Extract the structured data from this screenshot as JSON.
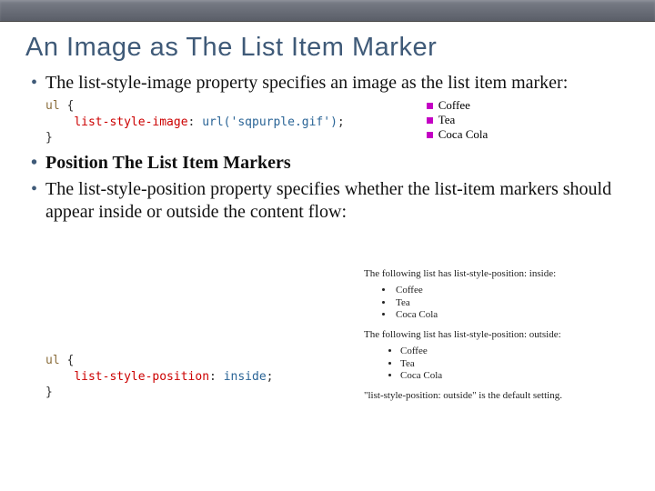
{
  "title": "An Image as The List Item Marker",
  "bullets": {
    "b1": "The list-style-image property specifies an image as the list item marker:",
    "b2": "Position The List Item Markers",
    "b3": "The list-style-position property specifies whether the list-item markers should appear inside or outside the content flow:"
  },
  "code1": {
    "selector": "ul",
    "brace_open": " {",
    "indent": "    ",
    "property": "list-style-image",
    "colon": ": ",
    "value": "url('sqpurple.gif')",
    "semi": ";",
    "brace_close": "}"
  },
  "example1": {
    "items": [
      "Coffee",
      "Tea",
      "Coca Cola"
    ]
  },
  "code2": {
    "selector": "ul",
    "brace_open": " {",
    "indent": "    ",
    "property": "list-style-position",
    "colon": ": ",
    "value": "inside",
    "semi": ";",
    "brace_close": "}"
  },
  "position_example": {
    "caption_inside": "The following list has list-style-position: inside:",
    "caption_outside": "The following list has list-style-position: outside:",
    "items": [
      "Coffee",
      "Tea",
      "Coca Cola"
    ],
    "note": "\"list-style-position: outside\" is the default setting."
  }
}
